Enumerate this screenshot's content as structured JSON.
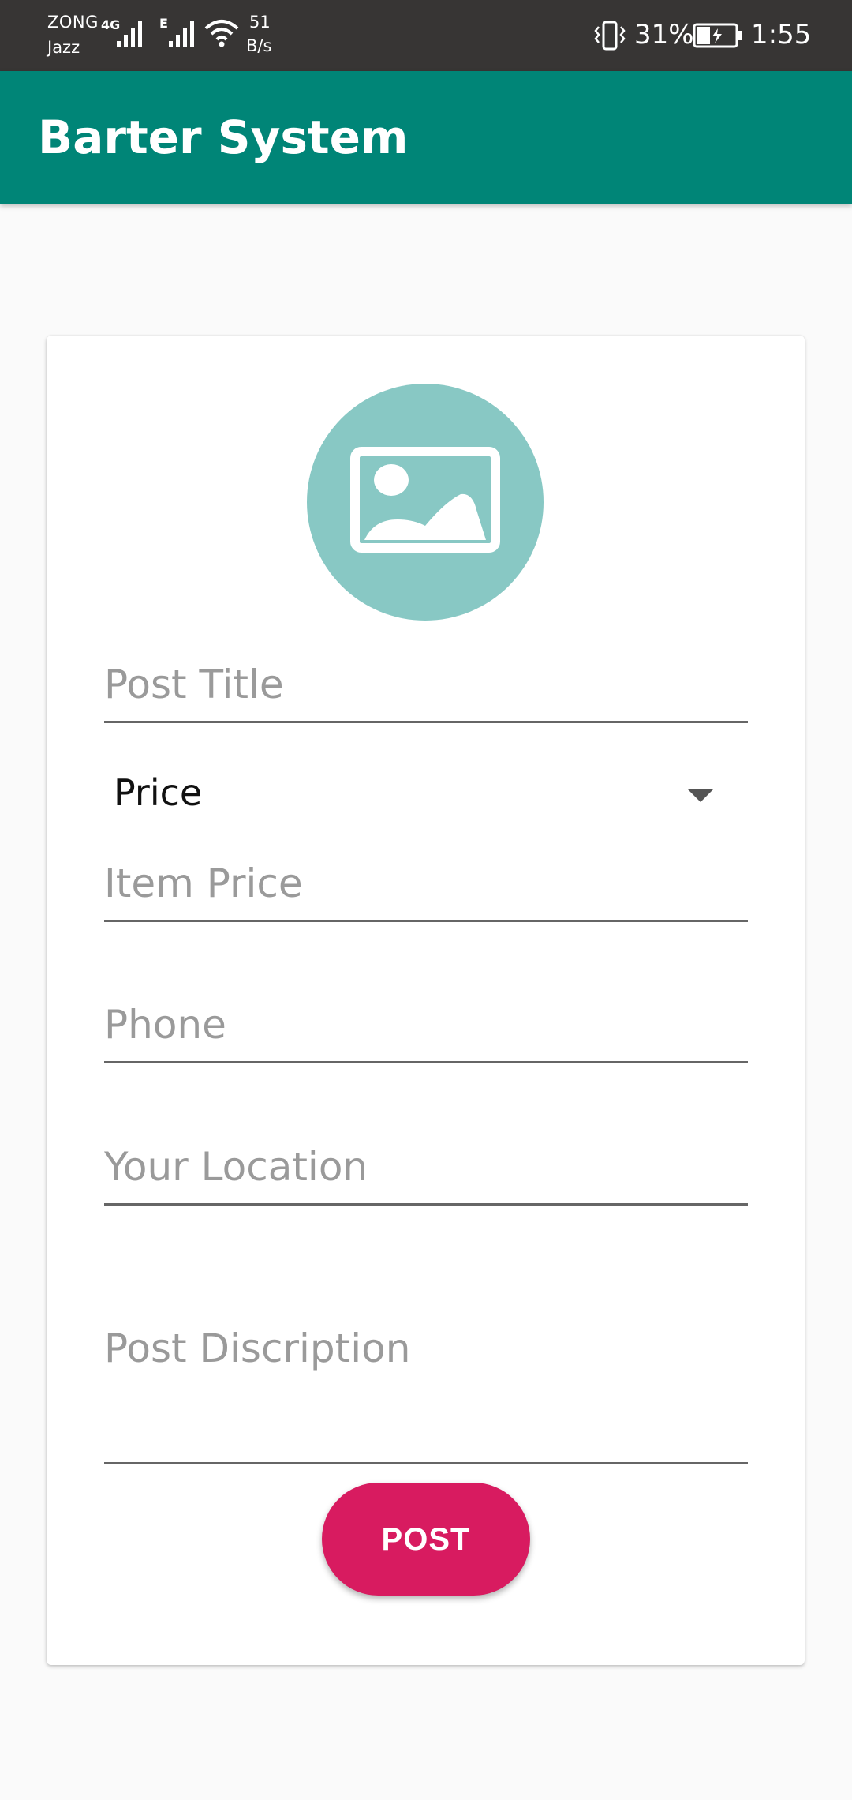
{
  "status_bar": {
    "carrier_top": "ZONG",
    "carrier_bottom": "Jazz",
    "network_type": "4G",
    "network_type_2": "E",
    "speed_value": "51",
    "speed_unit": "B/s",
    "battery_percent": "31%",
    "time": "1:55",
    "icons": [
      "signal-icon",
      "wifi-icon",
      "vibrate-icon",
      "battery-charging-icon"
    ]
  },
  "app_bar": {
    "title": "Barter System",
    "color": "#008577"
  },
  "form": {
    "image_picker_icon": "image-placeholder-icon",
    "post_title_placeholder": "Post Title",
    "price_spinner_value": "Price",
    "item_price_placeholder": "Item Price",
    "phone_placeholder": "Phone",
    "location_placeholder": "Your Location",
    "description_placeholder": "Post Discription",
    "post_button_label": "POST",
    "accent_color": "#d81b60",
    "picker_color": "#88c8c4"
  }
}
